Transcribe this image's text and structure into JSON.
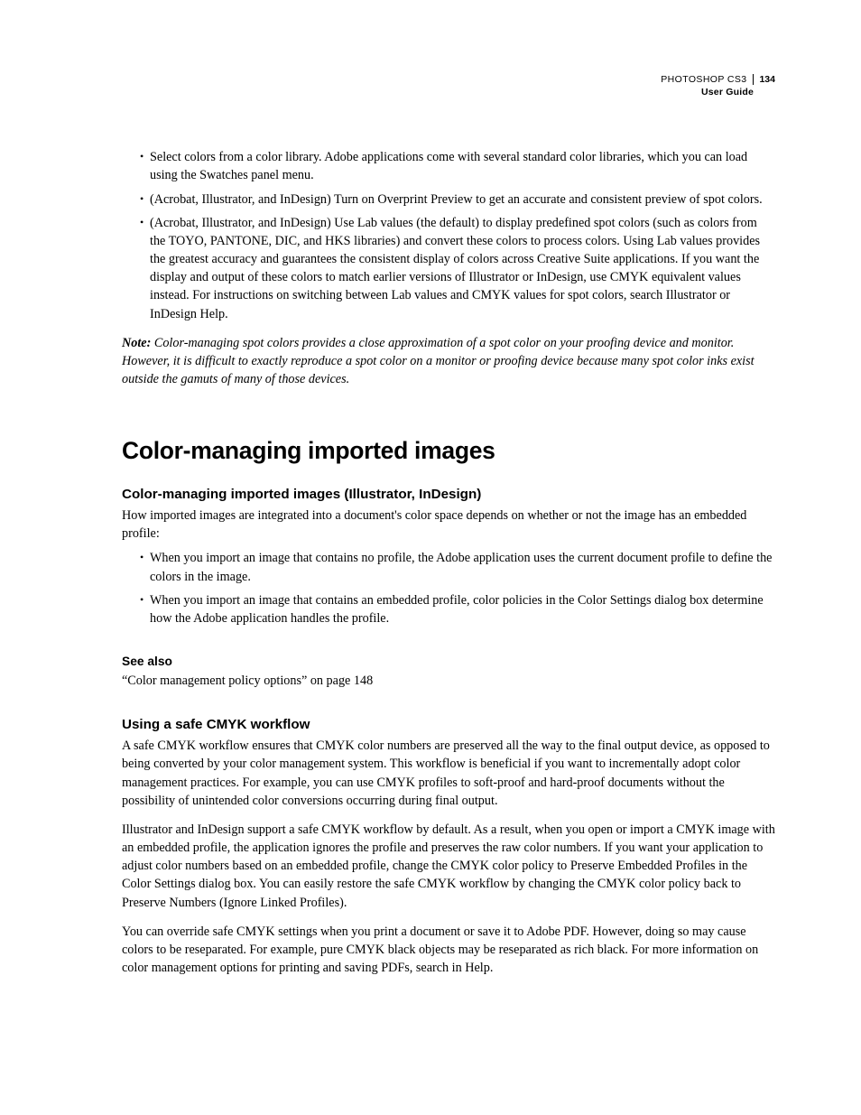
{
  "header": {
    "product": "PHOTOSHOP CS3",
    "guide": "User Guide",
    "page": "134"
  },
  "top_bullets": [
    "Select colors from a color library. Adobe applications come with several standard color libraries, which you can load using the Swatches panel menu.",
    "(Acrobat, Illustrator, and InDesign) Turn on Overprint Preview to get an accurate and consistent preview of spot colors.",
    "(Acrobat, Illustrator, and InDesign) Use Lab values (the default) to display predefined spot colors (such as colors from the TOYO, PANTONE, DIC, and HKS libraries) and convert these colors to process colors. Using Lab values provides the greatest accuracy and guarantees the consistent display of colors across Creative Suite applications. If you want the display and output of these colors to match earlier versions of Illustrator or InDesign, use CMYK equivalent values instead. For instructions on switching between Lab values and CMYK values for spot colors, search Illustrator or InDesign Help."
  ],
  "note": {
    "label": "Note:",
    "text": " Color-managing spot colors provides a close approximation of a spot color on your proofing device and monitor. However, it is difficult to exactly reproduce a spot color on a monitor or proofing device because many spot color inks exist outside the gamuts of many of those devices."
  },
  "section_title": "Color-managing imported images",
  "sub1": {
    "title": "Color-managing imported images (Illustrator, InDesign)",
    "intro": "How imported images are integrated into a document's color space depends on whether or not the image has an embedded profile:",
    "bullets": [
      "When you import an image that contains no profile, the Adobe application uses the current document profile to define the colors in the image.",
      "When you import an image that contains an embedded profile, color policies in the Color Settings dialog box determine how the Adobe application handles the profile."
    ],
    "seealso_heading": "See also",
    "seealso_text": "“Color management policy options” on page 148"
  },
  "sub2": {
    "title": "Using a safe CMYK workflow",
    "para1": "A safe CMYK workflow ensures that CMYK color numbers are preserved all the way to the final output device, as opposed to being converted by your color management system. This workflow is beneficial if you want to incrementally adopt color management practices. For example, you can use CMYK profiles to soft-proof and hard-proof documents without the possibility of unintended color conversions occurring during final output.",
    "para2": "Illustrator and InDesign support a safe CMYK workflow by default. As a result, when you open or import a CMYK image with an embedded profile, the application ignores the profile and preserves the raw color numbers. If you want your application to adjust color numbers based on an embedded profile, change the CMYK color policy to Preserve Embedded Profiles in the Color Settings dialog box. You can easily restore the safe CMYK workflow by changing the CMYK color policy back to Preserve Numbers (Ignore Linked Profiles).",
    "para3": "You can override safe CMYK settings when you print a document or save it to Adobe PDF. However, doing so may cause colors to be reseparated. For example, pure CMYK black objects may be reseparated as rich black. For more information on color management options for printing and saving PDFs, search in Help."
  }
}
